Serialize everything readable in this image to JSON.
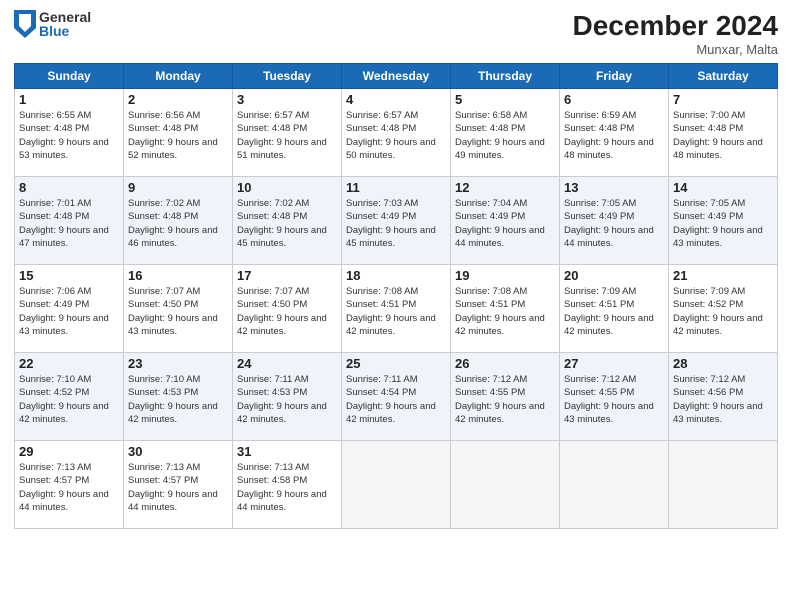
{
  "header": {
    "logo": {
      "general": "General",
      "blue": "Blue"
    },
    "title": "December 2024",
    "location": "Munxar, Malta"
  },
  "weekdays": [
    "Sunday",
    "Monday",
    "Tuesday",
    "Wednesday",
    "Thursday",
    "Friday",
    "Saturday"
  ],
  "weeks": [
    [
      {
        "day": "1",
        "sunrise": "6:55 AM",
        "sunset": "4:48 PM",
        "daylight": "9 hours and 53 minutes."
      },
      {
        "day": "2",
        "sunrise": "6:56 AM",
        "sunset": "4:48 PM",
        "daylight": "9 hours and 52 minutes."
      },
      {
        "day": "3",
        "sunrise": "6:57 AM",
        "sunset": "4:48 PM",
        "daylight": "9 hours and 51 minutes."
      },
      {
        "day": "4",
        "sunrise": "6:57 AM",
        "sunset": "4:48 PM",
        "daylight": "9 hours and 50 minutes."
      },
      {
        "day": "5",
        "sunrise": "6:58 AM",
        "sunset": "4:48 PM",
        "daylight": "9 hours and 49 minutes."
      },
      {
        "day": "6",
        "sunrise": "6:59 AM",
        "sunset": "4:48 PM",
        "daylight": "9 hours and 48 minutes."
      },
      {
        "day": "7",
        "sunrise": "7:00 AM",
        "sunset": "4:48 PM",
        "daylight": "9 hours and 48 minutes."
      }
    ],
    [
      {
        "day": "8",
        "sunrise": "7:01 AM",
        "sunset": "4:48 PM",
        "daylight": "9 hours and 47 minutes."
      },
      {
        "day": "9",
        "sunrise": "7:02 AM",
        "sunset": "4:48 PM",
        "daylight": "9 hours and 46 minutes."
      },
      {
        "day": "10",
        "sunrise": "7:02 AM",
        "sunset": "4:48 PM",
        "daylight": "9 hours and 45 minutes."
      },
      {
        "day": "11",
        "sunrise": "7:03 AM",
        "sunset": "4:49 PM",
        "daylight": "9 hours and 45 minutes."
      },
      {
        "day": "12",
        "sunrise": "7:04 AM",
        "sunset": "4:49 PM",
        "daylight": "9 hours and 44 minutes."
      },
      {
        "day": "13",
        "sunrise": "7:05 AM",
        "sunset": "4:49 PM",
        "daylight": "9 hours and 44 minutes."
      },
      {
        "day": "14",
        "sunrise": "7:05 AM",
        "sunset": "4:49 PM",
        "daylight": "9 hours and 43 minutes."
      }
    ],
    [
      {
        "day": "15",
        "sunrise": "7:06 AM",
        "sunset": "4:49 PM",
        "daylight": "9 hours and 43 minutes."
      },
      {
        "day": "16",
        "sunrise": "7:07 AM",
        "sunset": "4:50 PM",
        "daylight": "9 hours and 43 minutes."
      },
      {
        "day": "17",
        "sunrise": "7:07 AM",
        "sunset": "4:50 PM",
        "daylight": "9 hours and 42 minutes."
      },
      {
        "day": "18",
        "sunrise": "7:08 AM",
        "sunset": "4:51 PM",
        "daylight": "9 hours and 42 minutes."
      },
      {
        "day": "19",
        "sunrise": "7:08 AM",
        "sunset": "4:51 PM",
        "daylight": "9 hours and 42 minutes."
      },
      {
        "day": "20",
        "sunrise": "7:09 AM",
        "sunset": "4:51 PM",
        "daylight": "9 hours and 42 minutes."
      },
      {
        "day": "21",
        "sunrise": "7:09 AM",
        "sunset": "4:52 PM",
        "daylight": "9 hours and 42 minutes."
      }
    ],
    [
      {
        "day": "22",
        "sunrise": "7:10 AM",
        "sunset": "4:52 PM",
        "daylight": "9 hours and 42 minutes."
      },
      {
        "day": "23",
        "sunrise": "7:10 AM",
        "sunset": "4:53 PM",
        "daylight": "9 hours and 42 minutes."
      },
      {
        "day": "24",
        "sunrise": "7:11 AM",
        "sunset": "4:53 PM",
        "daylight": "9 hours and 42 minutes."
      },
      {
        "day": "25",
        "sunrise": "7:11 AM",
        "sunset": "4:54 PM",
        "daylight": "9 hours and 42 minutes."
      },
      {
        "day": "26",
        "sunrise": "7:12 AM",
        "sunset": "4:55 PM",
        "daylight": "9 hours and 42 minutes."
      },
      {
        "day": "27",
        "sunrise": "7:12 AM",
        "sunset": "4:55 PM",
        "daylight": "9 hours and 43 minutes."
      },
      {
        "day": "28",
        "sunrise": "7:12 AM",
        "sunset": "4:56 PM",
        "daylight": "9 hours and 43 minutes."
      }
    ],
    [
      {
        "day": "29",
        "sunrise": "7:13 AM",
        "sunset": "4:57 PM",
        "daylight": "9 hours and 44 minutes."
      },
      {
        "day": "30",
        "sunrise": "7:13 AM",
        "sunset": "4:57 PM",
        "daylight": "9 hours and 44 minutes."
      },
      {
        "day": "31",
        "sunrise": "7:13 AM",
        "sunset": "4:58 PM",
        "daylight": "9 hours and 44 minutes."
      },
      null,
      null,
      null,
      null
    ]
  ]
}
